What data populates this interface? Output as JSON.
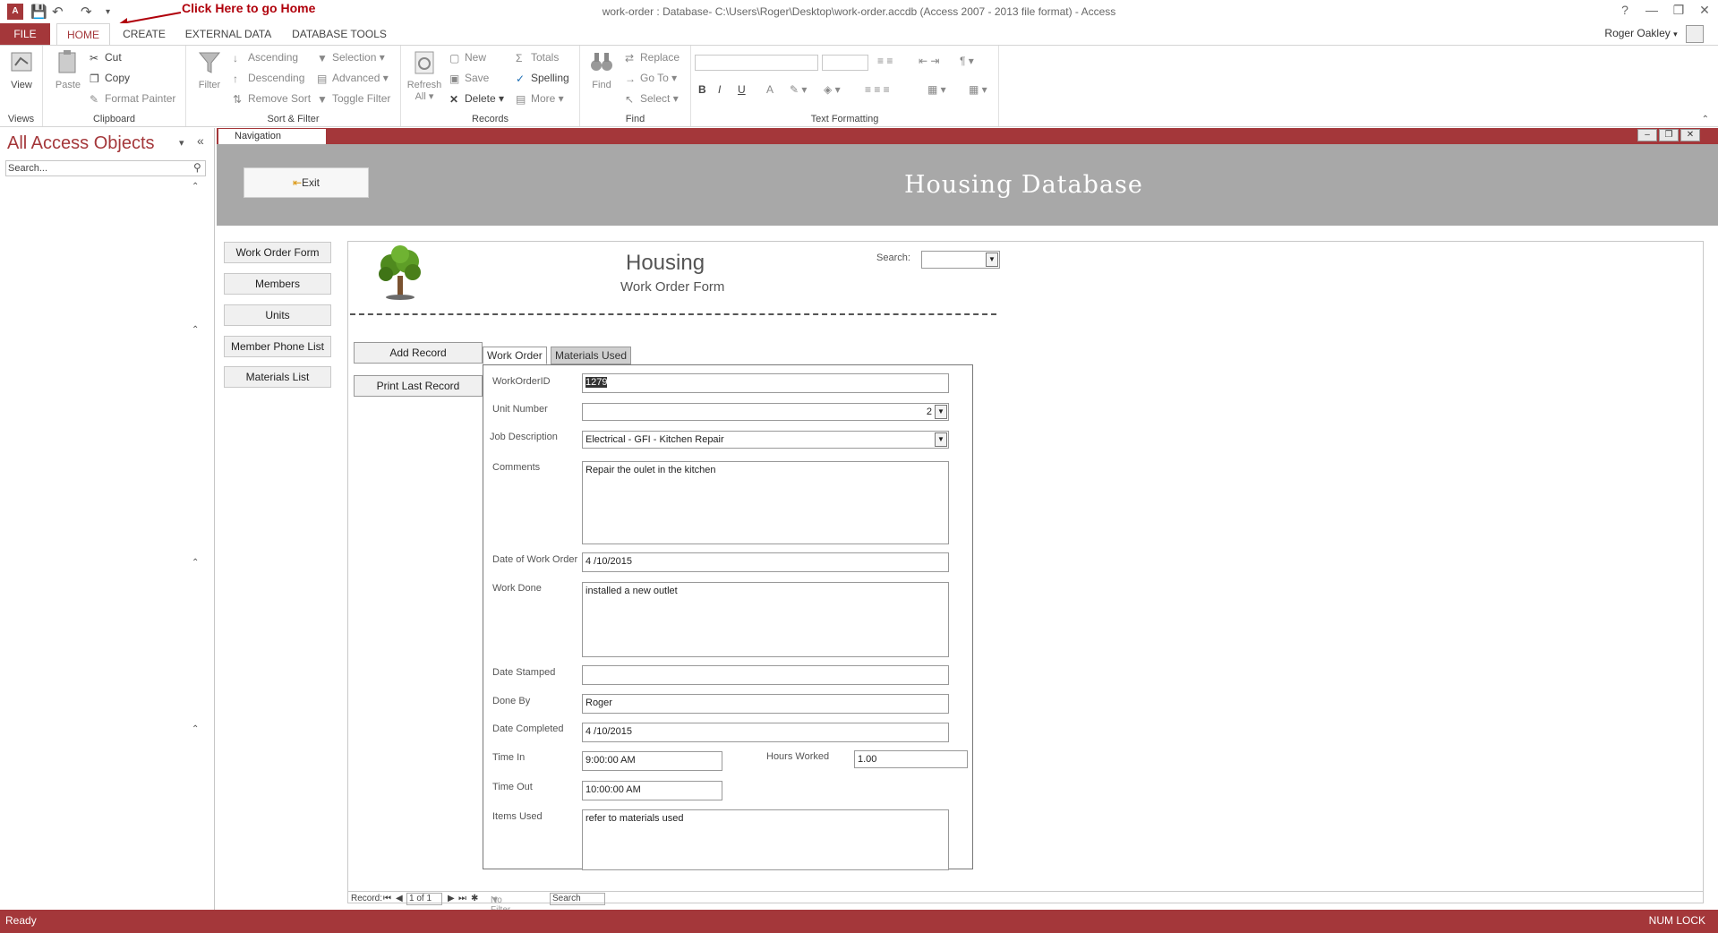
{
  "titlebar": {
    "title": "work-order : Database- C:\\Users\\Roger\\Desktop\\work-order.accdb (Access 2007 - 2013 file format) - Access",
    "annotation": "Click Here to go Home",
    "help": "?",
    "minimize": "—",
    "restore": "❐",
    "close": "✕"
  },
  "tabs": {
    "file": "FILE",
    "home": "HOME",
    "create": "CREATE",
    "external_data": "EXTERNAL DATA",
    "database_tools": "DATABASE TOOLS"
  },
  "user": {
    "name": "Roger Oakley"
  },
  "ribbon": {
    "views": {
      "view": "View",
      "group": "Views"
    },
    "clipboard": {
      "paste": "Paste",
      "cut": "Cut",
      "copy": "Copy",
      "format_painter": "Format Painter",
      "group": "Clipboard"
    },
    "sort_filter": {
      "filter": "Filter",
      "ascending": "Ascending",
      "descending": "Descending",
      "remove_sort": "Remove Sort",
      "selection": "Selection",
      "advanced": "Advanced",
      "toggle_filter": "Toggle Filter",
      "group": "Sort & Filter"
    },
    "records": {
      "refresh_all": "Refresh",
      "refresh_all_2": "All",
      "new": "New",
      "save": "Save",
      "delete": "Delete",
      "totals": "Totals",
      "spelling": "Spelling",
      "more": "More",
      "group": "Records"
    },
    "find": {
      "find": "Find",
      "replace": "Replace",
      "go_to": "Go To",
      "select": "Select",
      "group": "Find"
    },
    "text_formatting": {
      "bold": "B",
      "italic": "I",
      "underline": "U",
      "font_color": "A",
      "group": "Text Formatting"
    }
  },
  "navpane": {
    "title": "All Access Objects",
    "search_placeholder": "Search..."
  },
  "document": {
    "tab_label": "Navigation",
    "exit_label": "Exit",
    "db_title": "Housing Database",
    "menu": [
      "Work Order Form",
      "Members",
      "Units",
      "Member Phone List",
      "Materials List"
    ]
  },
  "form": {
    "title": "Housing",
    "subtitle": "Work Order Form",
    "search_label": "Search:",
    "add_record": "Add Record",
    "print_last_record": "Print Last Record",
    "tabs": [
      "Work Order",
      "Materials Used"
    ],
    "labels": {
      "work_order_id": "WorkOrderID",
      "unit_number": "Unit Number",
      "job_description": "Job Description",
      "comments": "Comments",
      "date_of_work_order": "Date of Work Order",
      "work_done": "Work Done",
      "date_stamped": "Date Stamped",
      "done_by": "Done By",
      "date_completed": "Date Completed",
      "time_in": "Time In",
      "hours_worked": "Hours Worked",
      "time_out": "Time Out",
      "items_used": "Items Used"
    },
    "values": {
      "work_order_id": "1279",
      "unit_number": "2",
      "job_description": "Electrical - GFI - Kitchen Repair",
      "comments": "Repair the oulet in the kitchen",
      "date_of_work_order": "4 /10/2015",
      "work_done": "installed a new outlet",
      "date_stamped": "",
      "done_by": "Roger",
      "date_completed": "4 /10/2015",
      "time_in": "9:00:00 AM",
      "hours_worked": "1.00",
      "time_out": "10:00:00 AM",
      "items_used": "refer to materials used"
    }
  },
  "recordnav": {
    "label": "Record:",
    "position": "1 of 1",
    "filter": "No Filter",
    "search": "Search"
  },
  "status": {
    "left": "Ready",
    "right": "NUM LOCK"
  },
  "colors": {
    "accent": "#a4373a",
    "header_gray": "#a8a8a8"
  }
}
